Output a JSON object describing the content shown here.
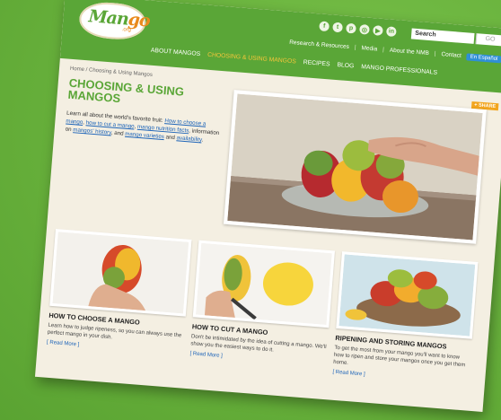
{
  "brand": {
    "logo_text_before": "Man",
    "logo_text_o": "g",
    "logo_text_after": "o",
    "logo_sub": ".org"
  },
  "colors": {
    "green": "#5aa637",
    "orange": "#e98a1c",
    "link_blue": "#1c63b8",
    "active_nav": "#f6c63a"
  },
  "social_icons": [
    "facebook-icon",
    "twitter-icon",
    "pinterest-icon",
    "instagram-icon",
    "youtube-icon",
    "linkedin-icon"
  ],
  "search": {
    "label": "Search",
    "go_label": "GO"
  },
  "topnav": {
    "items": [
      "Research & Resources",
      "Media",
      "About the NMB",
      "Contact"
    ],
    "lang_button": "En Español"
  },
  "mainnav": {
    "items": [
      "ABOUT MANGOS",
      "CHOOSING & USING MANGOS",
      "RECIPES",
      "BLOG",
      "MANGO PROFESSIONALS"
    ]
  },
  "breadcrumb": "Home / Choosing & Using Mangos",
  "page_title": "CHOOSING & USING MANGOS",
  "intro": {
    "t1": "Learn all about the world's favorite fruit: ",
    "l1": "How to choose a mango",
    "t2": ", ",
    "l2": "how to cut a mango",
    "t3": ", ",
    "l3": "mango nutrition facts",
    "t4": ", information on ",
    "l4": "mangos' history",
    "t5": ", and ",
    "l5": "mango varieties",
    "t6": " and ",
    "l6": "availability",
    "t7": "."
  },
  "share_label": "+ SHARE",
  "cards": [
    {
      "title": "HOW TO CHOOSE A MANGO",
      "desc": "Learn how to judge ripeness, so you can always use the perfect mango in your dish.",
      "link": "[ Read More ]"
    },
    {
      "title": "HOW TO CUT A MANGO",
      "desc": "Don't be intimidated by the idea of cutting a mango. We'll show you the easiest ways to do it.",
      "link": "[ Read More ]"
    },
    {
      "title": "RIPENING AND STORING MANGOS",
      "desc": "To get the most from your mango you'll want to know how to ripen and store your mangos once you get them home.",
      "link": "[ Read More ]"
    }
  ]
}
